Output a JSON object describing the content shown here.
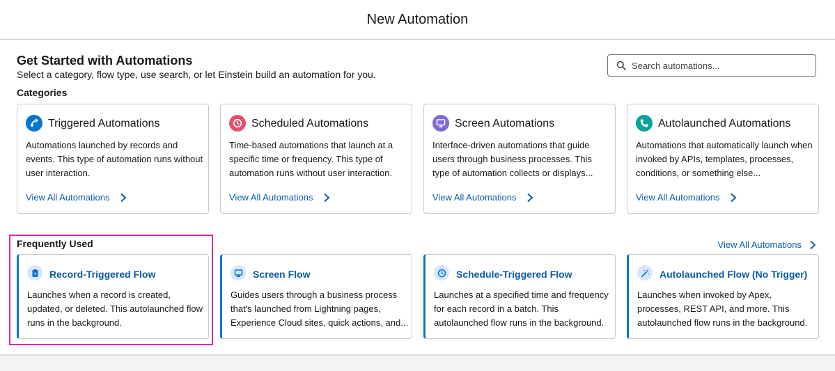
{
  "header": {
    "title": "New Automation"
  },
  "intro": {
    "title": "Get Started with Automations",
    "subtitle": "Select a category, flow type, use search, or let Einstein build an automation for you."
  },
  "search": {
    "placeholder": "Search automations..."
  },
  "categories": {
    "heading": "Categories",
    "items": [
      {
        "title": "Triggered Automations",
        "description": "Automations launched by records and events. This type of automation runs without user interaction.",
        "link": "View All Automations",
        "color": "#0176d3",
        "icon": "trigger-icon"
      },
      {
        "title": "Scheduled Automations",
        "description": "Time-based automations that launch at a specific time or frequency. This type of automation runs without user interaction.",
        "link": "View All Automations",
        "color": "#e3506a",
        "icon": "clock-icon"
      },
      {
        "title": "Screen Automations",
        "description": "Interface-driven automations that guide users through business processes. This type of automation collects or displays...",
        "link": "View All Automations",
        "color": "#7f6ad8",
        "icon": "monitor-icon"
      },
      {
        "title": "Autolaunched Automations",
        "description": "Automations that automatically launch when invoked by APIs, templates, processes, conditions, or something else...",
        "link": "View All Automations",
        "color": "#06a59a",
        "icon": "phone-icon"
      }
    ]
  },
  "frequently_used": {
    "heading": "Frequently Used",
    "view_all": "View All Automations",
    "items": [
      {
        "title": "Record-Triggered Flow",
        "description": "Launches when a record is created, updated, or deleted. This autolaunched flow runs in the background.",
        "icon": "clipboard-bolt-icon"
      },
      {
        "title": "Screen Flow",
        "description": "Guides users through a business process that's launched from Lightning pages, Experience Cloud sites, quick actions, and...",
        "icon": "monitor-icon"
      },
      {
        "title": "Schedule-Triggered Flow",
        "description": "Launches at a specified time and frequency for each record in a batch. This autolaunched flow runs in the background.",
        "icon": "clock-icon"
      },
      {
        "title": "Autolaunched Flow (No Trigger)",
        "description": "Launches when invoked by Apex, processes, REST API, and more. This autolaunched flow runs in the background.",
        "icon": "magic-wand-icon"
      }
    ]
  },
  "colors": {
    "link": "#0b5cab",
    "accent": "#0176d3",
    "highlight": "#e026a8"
  }
}
